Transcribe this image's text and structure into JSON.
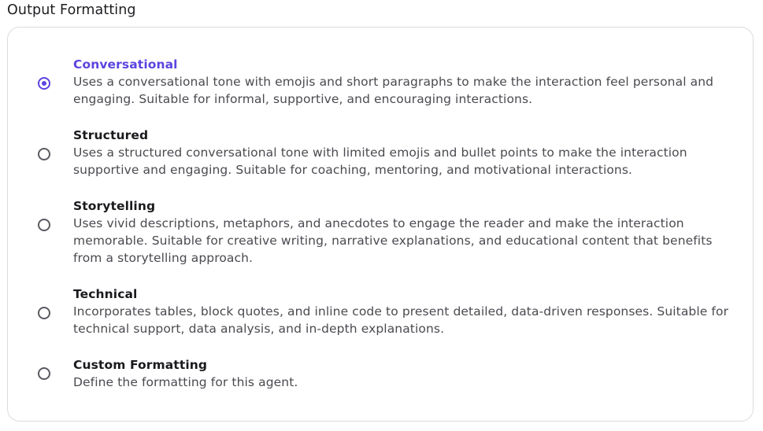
{
  "section": {
    "title": "Output Formatting"
  },
  "options": [
    {
      "title": "Conversational",
      "description": "Uses a conversational tone with emojis and short paragraphs to make the interaction feel personal and engaging. Suitable for informal, supportive, and encouraging interactions.",
      "selected": true
    },
    {
      "title": "Structured",
      "description": "Uses a structured conversational tone with limited emojis and bullet points to make the interaction supportive and engaging. Suitable for coaching, mentoring, and motivational interactions.",
      "selected": false
    },
    {
      "title": "Storytelling",
      "description": "Uses vivid descriptions, metaphors, and anecdotes to engage the reader and make the interaction memorable. Suitable for creative writing, narrative explanations, and educational content that benefits from a storytelling approach.",
      "selected": false
    },
    {
      "title": "Technical",
      "description": "Incorporates tables, block quotes, and inline code to present detailed, data-driven responses. Suitable for technical support, data analysis, and in-depth explanations.",
      "selected": false
    },
    {
      "title": "Custom Formatting",
      "description": "Define the formatting for this agent.",
      "selected": false
    }
  ],
  "colors": {
    "accent": "#5b45e0",
    "border": "#dcdce0",
    "text_primary": "#1a1a1e",
    "text_secondary": "#4a4a50"
  }
}
